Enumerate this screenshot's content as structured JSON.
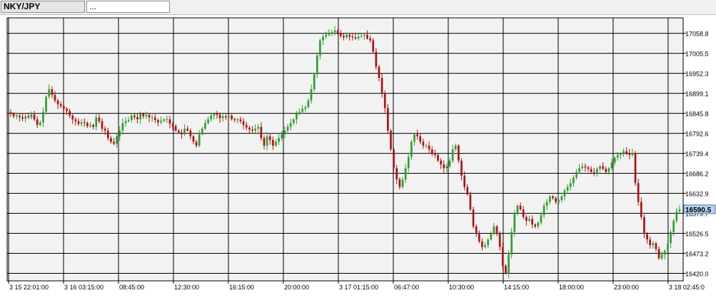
{
  "tabs": [
    {
      "label": "NKY/JPY",
      "active": true
    },
    {
      "label": "...",
      "active": false
    }
  ],
  "colors": {
    "background": "#f2f2f2",
    "grid": "#000000",
    "up": "#2e9e2e",
    "down": "#b01010",
    "current_price_bg": "#b9d1ea"
  },
  "chart_data": {
    "type": "candlestick",
    "symbol": "NKY/JPY",
    "ylim": [
      16400,
      17100
    ],
    "y_ticks": [
      "17058.8",
      "17005.5",
      "16952.3",
      "16899.1",
      "16845.8",
      "16792.6",
      "16739.4",
      "16686.2",
      "16632.9",
      "16579.7",
      "16526.5",
      "16473.2",
      "16420.0"
    ],
    "x_ticks": [
      "3 15 22:01:00",
      "3 16 03:15:00",
      "08:45:00",
      "12:30:00",
      "16:15:00",
      "20:00:00",
      "3 17 01:15:00",
      "06:47:00",
      "10:30:00",
      "14:15:00",
      "18:00:00",
      "23:00:00",
      "3 18 02:45:0"
    ],
    "current_price": "16590.5",
    "grid": true,
    "closes": [
      16845,
      16838,
      16840,
      16836,
      16832,
      16838,
      16835,
      16843,
      16830,
      16815,
      16822,
      16850,
      16890,
      16910,
      16895,
      16880,
      16870,
      16865,
      16858,
      16852,
      16840,
      16830,
      16825,
      16818,
      16822,
      16820,
      16812,
      16815,
      16810,
      16835,
      16825,
      16805,
      16800,
      16780,
      16770,
      16765,
      16785,
      16800,
      16820,
      16825,
      16828,
      16840,
      16836,
      16830,
      16845,
      16838,
      16842,
      16835,
      16835,
      16828,
      16822,
      16826,
      16830,
      16830,
      16818,
      16812,
      16800,
      16795,
      16790,
      16805,
      16800,
      16785,
      16770,
      16760,
      16790,
      16805,
      16820,
      16830,
      16840,
      16845,
      16842,
      16833,
      16838,
      16835,
      16840,
      16830,
      16828,
      16830,
      16825,
      16815,
      16808,
      16803,
      16800,
      16805,
      16810,
      16780,
      16760,
      16785,
      16775,
      16760,
      16770,
      16780,
      16790,
      16800,
      16810,
      16820,
      16830,
      16845,
      16850,
      16858,
      16862,
      16880,
      16910,
      16950,
      17000,
      17040,
      17050,
      17055,
      17058,
      17062,
      17066,
      17060,
      17052,
      17048,
      17055,
      17050,
      17048,
      17045,
      17050,
      17052,
      17055,
      17045,
      17040,
      17010,
      16970,
      16940,
      16900,
      16860,
      16800,
      16750,
      16700,
      16670,
      16650,
      16670,
      16700,
      16730,
      16770,
      16790,
      16785,
      16770,
      16760,
      16760,
      16750,
      16740,
      16735,
      16720,
      16710,
      16700,
      16705,
      16720,
      16750,
      16760,
      16720,
      16680,
      16650,
      16630,
      16590,
      16545,
      16525,
      16505,
      16490,
      16495,
      16510,
      16525,
      16545,
      16525,
      16490,
      16440,
      16420,
      16470,
      16530,
      16580,
      16600,
      16590,
      16570,
      16560,
      16565,
      16550,
      16545,
      16555,
      16575,
      16600,
      16610,
      16625,
      16620,
      16610,
      16615,
      16625,
      16640,
      16650,
      16660,
      16675,
      16690,
      16700,
      16705,
      16702,
      16698,
      16690,
      16688,
      16698,
      16705,
      16698,
      16690,
      16700,
      16715,
      16728,
      16735,
      16740,
      16745,
      16738,
      16735,
      16740,
      16660,
      16610,
      16570,
      16525,
      16510,
      16495,
      16500,
      16485,
      16460,
      16470,
      16480,
      16500,
      16530,
      16560,
      16585,
      16590
    ]
  }
}
